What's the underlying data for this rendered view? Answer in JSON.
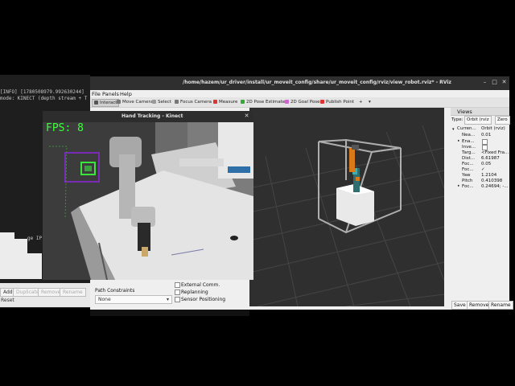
{
  "terminal": {
    "lines": [
      "[INFO] [1780508979.992630244]",
      "mode: KINECT (depth stream + T"
    ],
    "partial": "ge IP"
  },
  "motion_panel": {
    "add": "Add",
    "duplicate": "Duplicate",
    "remove": "Remove",
    "rename": "Rename",
    "reset": "Reset"
  },
  "rviz": {
    "title": "/home/hazem/ur_driver/install/ur_moveit_config/share/ur_moveit_config/rviz/view_robot.rviz* - RViz",
    "menu": [
      "File",
      "Panels",
      "Help"
    ],
    "tools": [
      "Interact",
      "Move Camera",
      "Select",
      "Focus Camera",
      "Measure",
      "2D Pose Estimate",
      "2D Goal Pose",
      "Publish Point"
    ],
    "views_panel": {
      "header": "Views",
      "type_label": "Type:",
      "type_value": "Orbit (rviz",
      "zero": "Zero",
      "rows": [
        {
          "name": "Curren...",
          "value": "Orbit (rviz)"
        },
        {
          "name": "Nea...",
          "value": "0.01"
        },
        {
          "name": "Ena...",
          "value": ""
        },
        {
          "name": "Inve...",
          "value": ""
        },
        {
          "name": "Targ...",
          "value": "<Fixed Fra..."
        },
        {
          "name": "Dist...",
          "value": "6.61987"
        },
        {
          "name": "Foc...",
          "value": "0.05"
        },
        {
          "name": "Foc...",
          "value": "✓"
        },
        {
          "name": "Yaw",
          "value": "1.2104"
        },
        {
          "name": "Pitch",
          "value": "0.410398"
        },
        {
          "name": "Foc...",
          "value": "0.24694; -..."
        }
      ],
      "save": "Save",
      "remove": "Remove",
      "rename": "Rename"
    },
    "lower_panel": {
      "path_constraints": "Path Constraints",
      "none": "None",
      "external_comm": "External Comm.",
      "replanning": "Replanning",
      "sensor_positioning": "Sensor Positioning"
    }
  },
  "hand_tracking": {
    "title": "Hand Tracking - Kinect",
    "fps": "FPS: 8"
  },
  "colors": {
    "tracking_box": "#7a2bb5",
    "hand_box": "#39e639",
    "fps_text": "#3cff3c"
  }
}
